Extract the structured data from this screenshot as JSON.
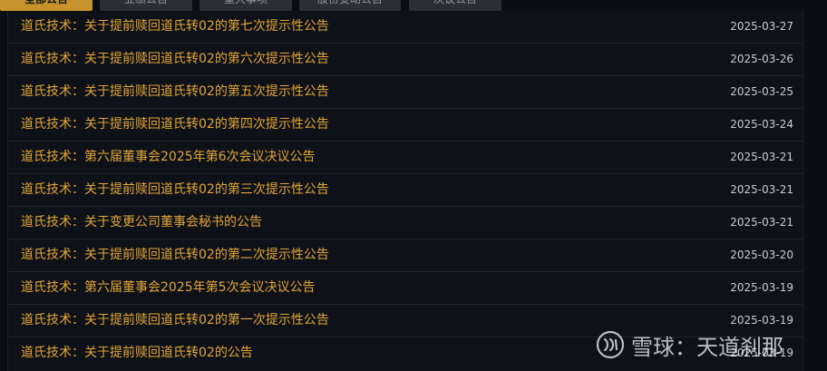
{
  "tabs": [
    {
      "label": "全部公告",
      "active": true
    },
    {
      "label": "业绩公告",
      "active": false
    },
    {
      "label": "重大事项",
      "active": false
    },
    {
      "label": "股份变动公告",
      "active": false
    },
    {
      "label": "决议公告",
      "active": false
    }
  ],
  "announcements": [
    {
      "title": "道氏技术：关于提前赎回道氏转02的第七次提示性公告",
      "date": "2025-03-27"
    },
    {
      "title": "道氏技术：关于提前赎回道氏转02的第六次提示性公告",
      "date": "2025-03-26"
    },
    {
      "title": "道氏技术：关于提前赎回道氏转02的第五次提示性公告",
      "date": "2025-03-25"
    },
    {
      "title": "道氏技术：关于提前赎回道氏转02的第四次提示性公告",
      "date": "2025-03-24"
    },
    {
      "title": "道氏技术：第六届董事会2025年第6次会议决议公告",
      "date": "2025-03-21"
    },
    {
      "title": "道氏技术：关于提前赎回道氏转02的第三次提示性公告",
      "date": "2025-03-21"
    },
    {
      "title": "道氏技术：关于变更公司董事会秘书的公告",
      "date": "2025-03-21"
    },
    {
      "title": "道氏技术：关于提前赎回道氏转02的第二次提示性公告",
      "date": "2025-03-20"
    },
    {
      "title": "道氏技术：第六届董事会2025年第5次会议决议公告",
      "date": "2025-03-19"
    },
    {
      "title": "道氏技术：关于提前赎回道氏转02的第一次提示性公告",
      "date": "2025-03-19"
    },
    {
      "title": "道氏技术：关于提前赎回道氏转02的公告",
      "date": "2025-03-19"
    }
  ],
  "watermark": {
    "text": "雪球：天道刹那",
    "icon": "xueqiu-logo-icon"
  },
  "colors": {
    "title": "#e2a738",
    "date": "#c9ccd2",
    "background": "#0b0d12",
    "active_tab": "#c8932d"
  }
}
